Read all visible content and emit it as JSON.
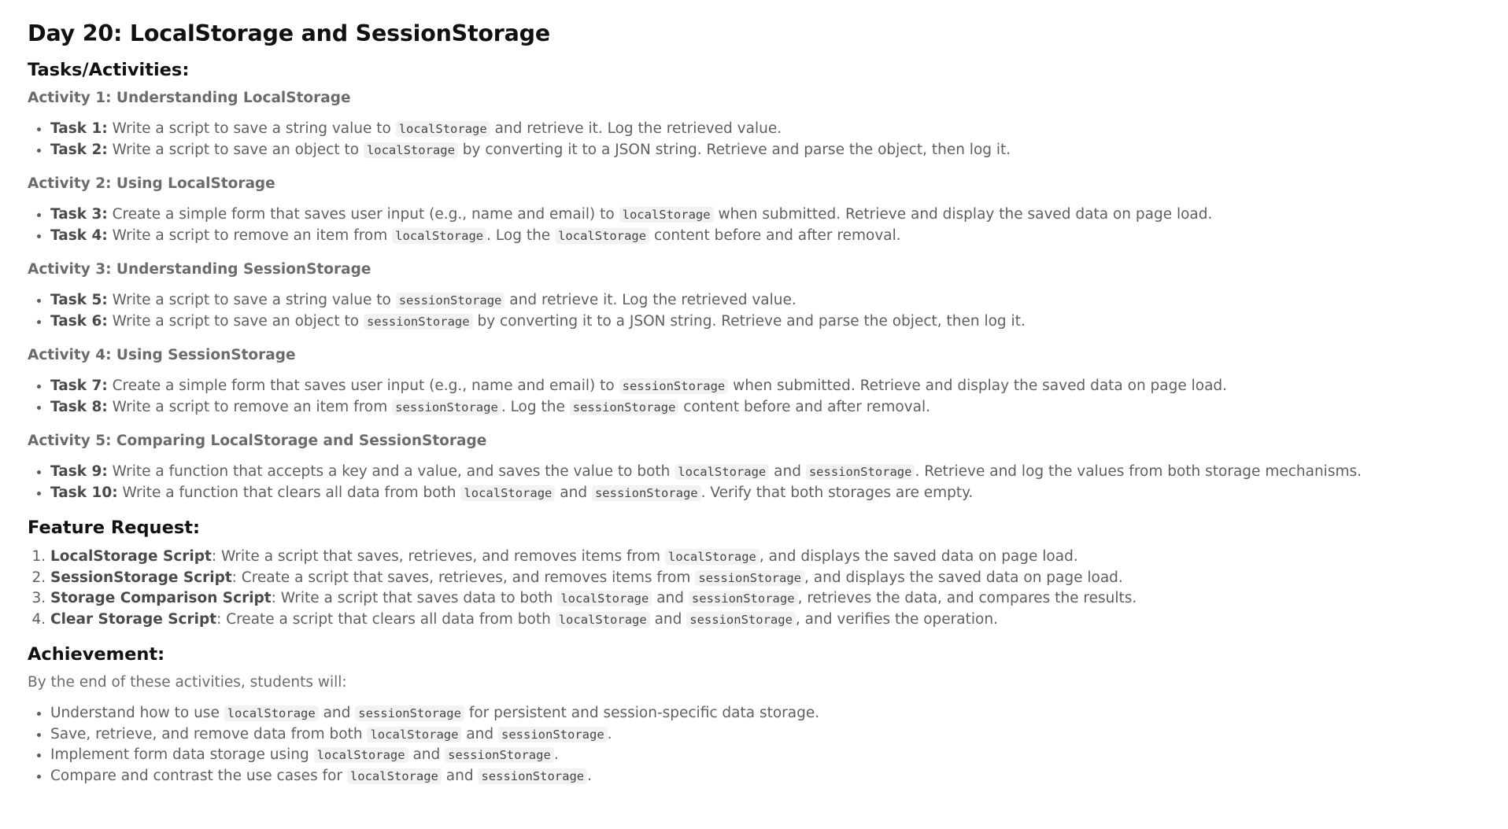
{
  "title": "Day 20: LocalStorage and SessionStorage",
  "tasks_heading": "Tasks/Activities:",
  "activities": [
    {
      "heading": "Activity 1: Understanding LocalStorage",
      "tasks": [
        {
          "label": "Task 1:",
          "parts": [
            " Write a script to save a string value to ",
            "localStorage",
            " and retrieve it. Log the retrieved value."
          ]
        },
        {
          "label": "Task 2:",
          "parts": [
            " Write a script to save an object to ",
            "localStorage",
            " by converting it to a JSON string. Retrieve and parse the object, then log it."
          ]
        }
      ]
    },
    {
      "heading": "Activity 2: Using LocalStorage",
      "tasks": [
        {
          "label": "Task 3:",
          "parts": [
            " Create a simple form that saves user input (e.g., name and email) to ",
            "localStorage",
            " when submitted. Retrieve and display the saved data on page load."
          ]
        },
        {
          "label": "Task 4:",
          "parts": [
            " Write a script to remove an item from ",
            "localStorage",
            ". Log the ",
            "localStorage",
            " content before and after removal."
          ]
        }
      ]
    },
    {
      "heading": "Activity 3: Understanding SessionStorage",
      "tasks": [
        {
          "label": "Task 5:",
          "parts": [
            " Write a script to save a string value to ",
            "sessionStorage",
            " and retrieve it. Log the retrieved value."
          ]
        },
        {
          "label": "Task 6:",
          "parts": [
            " Write a script to save an object to ",
            "sessionStorage",
            " by converting it to a JSON string. Retrieve and parse the object, then log it."
          ]
        }
      ]
    },
    {
      "heading": "Activity 4: Using SessionStorage",
      "tasks": [
        {
          "label": "Task 7:",
          "parts": [
            " Create a simple form that saves user input (e.g., name and email) to ",
            "sessionStorage",
            " when submitted. Retrieve and display the saved data on page load."
          ]
        },
        {
          "label": "Task 8:",
          "parts": [
            " Write a script to remove an item from ",
            "sessionStorage",
            ". Log the ",
            "sessionStorage",
            " content before and after removal."
          ]
        }
      ]
    },
    {
      "heading": "Activity 5: Comparing LocalStorage and SessionStorage",
      "tasks": [
        {
          "label": "Task 9:",
          "parts": [
            " Write a function that accepts a key and a value, and saves the value to both ",
            "localStorage",
            " and ",
            "sessionStorage",
            ". Retrieve and log the values from both storage mechanisms."
          ]
        },
        {
          "label": "Task 10:",
          "parts": [
            " Write a function that clears all data from both ",
            "localStorage",
            " and ",
            "sessionStorage",
            ". Verify that both storages are empty."
          ]
        }
      ]
    }
  ],
  "feature_heading": "Feature Request:",
  "features": [
    {
      "label": "LocalStorage Script",
      "parts": [
        ": Write a script that saves, retrieves, and removes items from ",
        "localStorage",
        ", and displays the saved data on page load."
      ]
    },
    {
      "label": "SessionStorage Script",
      "parts": [
        ": Create a script that saves, retrieves, and removes items from ",
        "sessionStorage",
        ", and displays the saved data on page load."
      ]
    },
    {
      "label": "Storage Comparison Script",
      "parts": [
        ": Write a script that saves data to both ",
        "localStorage",
        " and ",
        "sessionStorage",
        ", retrieves the data, and compares the results."
      ]
    },
    {
      "label": "Clear Storage Script",
      "parts": [
        ": Create a script that clears all data from both ",
        "localStorage",
        " and ",
        "sessionStorage",
        ", and verifies the operation."
      ]
    }
  ],
  "achievement_heading": "Achievement:",
  "achievement_intro": "By the end of these activities, students will:",
  "achievements": [
    {
      "parts": [
        "Understand how to use ",
        "localStorage",
        " and ",
        "sessionStorage",
        " for persistent and session-specific data storage."
      ]
    },
    {
      "parts": [
        "Save, retrieve, and remove data from both ",
        "localStorage",
        " and ",
        "sessionStorage",
        "."
      ]
    },
    {
      "parts": [
        "Implement form data storage using ",
        "localStorage",
        " and ",
        "sessionStorage",
        "."
      ]
    },
    {
      "parts": [
        "Compare and contrast the use cases for ",
        "localStorage",
        " and ",
        "sessionStorage",
        "."
      ]
    }
  ]
}
